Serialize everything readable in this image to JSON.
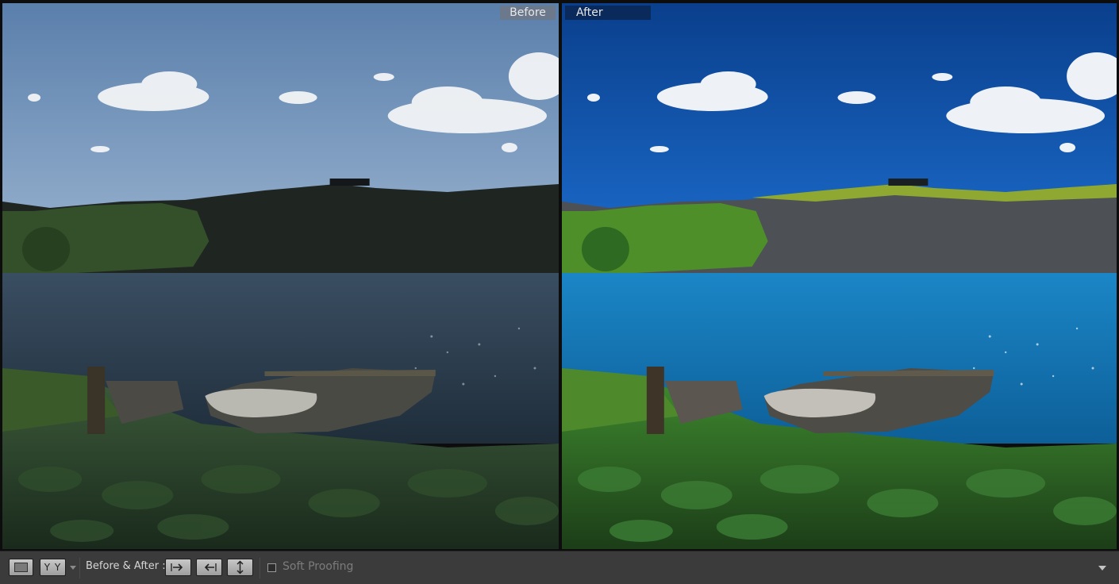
{
  "panes": {
    "before_label": "Before",
    "after_label": "After"
  },
  "toolbar": {
    "view_mode_icon": "loupe-view-icon",
    "compare_icon": "before-after-yy-icon",
    "compare_glyph": "Y Y",
    "before_after_label": "Before & After :",
    "copy_before_to_after_icon": "arrow-right-icon",
    "copy_after_to_before_icon": "arrow-left-icon",
    "swap_icon": "swap-icon",
    "soft_proofing_label": "Soft Proofing",
    "soft_proofing_checked": false,
    "toolbar_menu_icon": "chevron-down-icon"
  },
  "colors": {
    "before_sky": "#6e8fb6",
    "after_sky": "#1457b0",
    "toolbar_bg": "#3b3b3b"
  }
}
